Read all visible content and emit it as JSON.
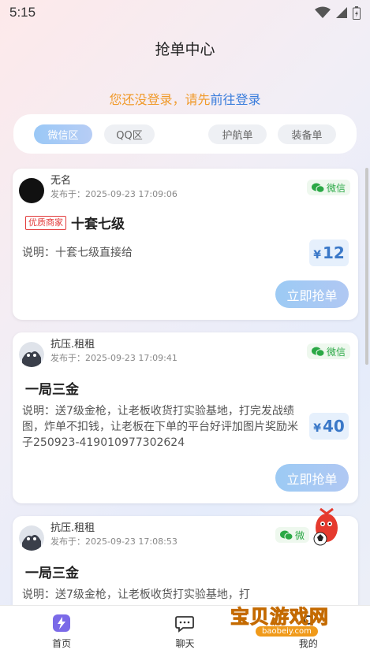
{
  "status_bar": {
    "time": "5:15"
  },
  "header": {
    "title": "抢单中心"
  },
  "login_hint": {
    "prefix": "您还没登录，请先",
    "link": "前往登录"
  },
  "tabs": [
    {
      "label": "微信区",
      "active": true
    },
    {
      "label": "QQ区",
      "active": false
    },
    {
      "label": "护航单",
      "active": false
    },
    {
      "label": "装备单",
      "active": false
    }
  ],
  "orders": [
    {
      "username": "无名",
      "posted": "发布于：2025-09-23 17:09:06",
      "platform": "微信",
      "tag": "优质商家",
      "title": "十套七级",
      "desc": "说明：十套七级直接给",
      "price_symbol": "¥",
      "price": "12",
      "button": "立即抢单"
    },
    {
      "username": "抗压.租租",
      "posted": "发布于：2025-09-23 17:09:41",
      "platform": "微信",
      "tag": "",
      "title": "一局三金",
      "desc": "说明：送7级金枪，让老板收货打实验基地，打完发战绩图，炸单不扣钱，让老板在下单的平台好评加图片奖励米子250923-419010977302624",
      "price_symbol": "¥",
      "price": "40",
      "button": "立即抢单"
    },
    {
      "username": "抗压.租租",
      "posted": "发布于：2025-09-23 17:08:53",
      "platform": "微",
      "tag": "",
      "title": "一局三金",
      "desc": "说明：送7级金枪，让老板收货打实验基地，打",
      "price_symbol": "",
      "price": "",
      "button": ""
    }
  ],
  "bottom_nav": [
    {
      "label": "首页",
      "icon": "home-lightning-icon",
      "active": true
    },
    {
      "label": "聊天",
      "icon": "chat-bubble-icon",
      "active": false
    },
    {
      "label": "我的",
      "icon": "profile-icon",
      "active": false
    }
  ],
  "watermark": {
    "text": "宝贝游戏网",
    "url": "baobeiy.com"
  },
  "colors": {
    "accent_blue": "#3a7ddc",
    "hint_orange": "#f09a2a",
    "price_blue": "#3a78c8",
    "wechat_green": "#2aa845",
    "tag_red": "#e23b3b"
  }
}
